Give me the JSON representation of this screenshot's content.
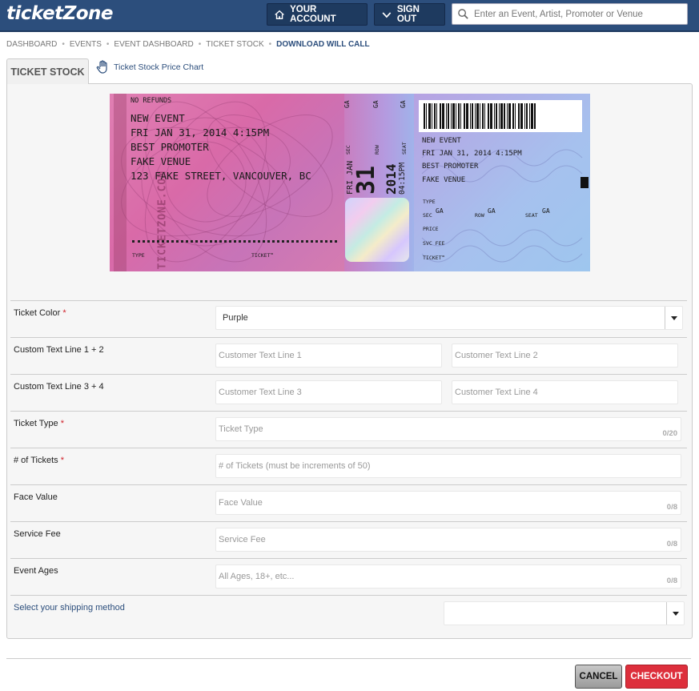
{
  "header": {
    "logo": "ticketZone",
    "account_label": "YOUR ACCOUNT",
    "signout_label": "SIGN OUT",
    "search_placeholder": "Enter an Event, Artist, Promoter or Venue",
    "colors": {
      "bar": "#2c4e7c",
      "button": "#1e3a5f"
    }
  },
  "breadcrumb": [
    "DASHBOARD",
    "EVENTS",
    "EVENT DASHBOARD",
    "TICKET STOCK",
    "DOWNLOAD WILL CALL"
  ],
  "tabs": {
    "active": "TICKET STOCK",
    "link": "Ticket Stock Price Chart",
    "link_icon": "hand-pointer-icon"
  },
  "ticket": {
    "no_refunds": "NO REFUNDS",
    "event": "NEW EVENT",
    "date": "FRI JAN 31, 2014 4:15PM",
    "promoter": "BEST PROMOTER",
    "venue": "FAKE VENUE",
    "address": "123 FAKE STREET, VANCOUVER, BC",
    "brand_vertical": "TICKETZONE.COM",
    "type_label": "TYPE",
    "ticket_tm": "TICKET™",
    "sec": "SEC",
    "row": "ROW",
    "seat": "SEAT",
    "ga": "GA",
    "dow_mon": "FRI JAN",
    "day": "31",
    "year": "2014",
    "time": "04:15PM",
    "stub_event": "NEW EVENT",
    "stub_date": "FRI JAN 31, 2014 4:15PM",
    "stub_promoter": "BEST PROMOTER",
    "stub_venue": "FAKE VENUE",
    "stub_type": "TYPE",
    "stub_price": "PRICE",
    "stub_svc_fee": "SVC FEE",
    "stub_ticket": "TICKET™"
  },
  "form": {
    "ticket_color_label": "Ticket Color",
    "ticket_color_value": "Purple",
    "custom12_label": "Custom Text Line 1 + 2",
    "custom1_placeholder": "Customer Text Line 1",
    "custom2_placeholder": "Customer Text Line 2",
    "custom34_label": "Custom Text Line 3 + 4",
    "custom3_placeholder": "Customer Text Line 3",
    "custom4_placeholder": "Customer Text Line 4",
    "ticket_type_label": "Ticket Type",
    "ticket_type_placeholder": "Ticket Type",
    "ticket_type_counter": "0/20",
    "num_tickets_label": "# of Tickets",
    "num_tickets_placeholder": "# of Tickets (must be increments of 50)",
    "face_value_label": "Face Value",
    "face_value_placeholder": "Face Value",
    "face_value_counter": "0/8",
    "service_fee_label": "Service Fee",
    "service_fee_placeholder": "Service Fee",
    "service_fee_counter": "0/8",
    "event_ages_label": "Event Ages",
    "event_ages_placeholder": "All Ages, 18+, etc...",
    "event_ages_counter": "0/8",
    "shipping_label": "Select your shipping method",
    "shipping_value": "",
    "required_mark": "*"
  },
  "footer": {
    "cancel_label": "CANCEL",
    "checkout_label": "CHECKOUT",
    "checkout_color": "#dd2f3c"
  }
}
